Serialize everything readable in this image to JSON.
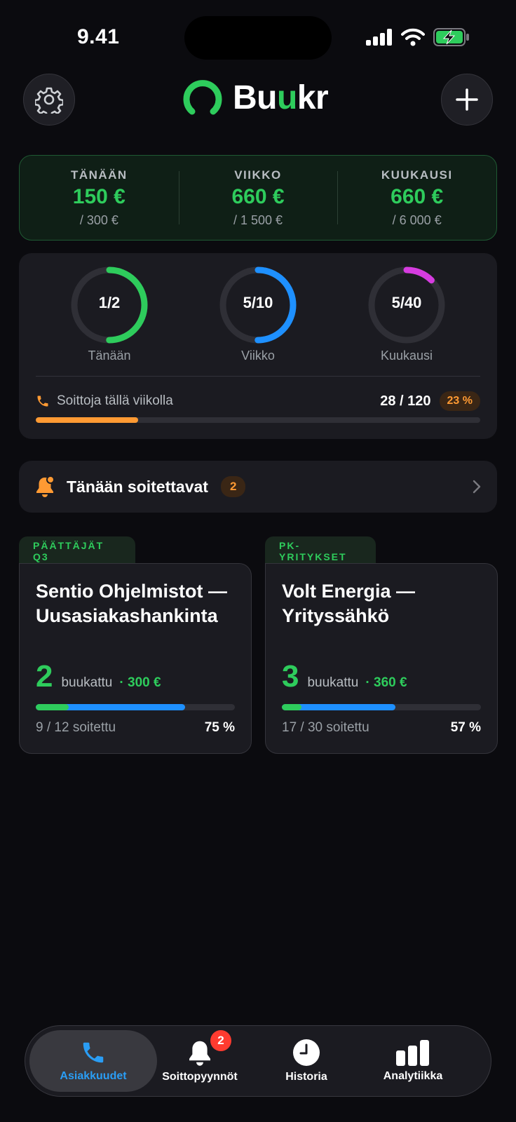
{
  "status_bar": {
    "time": "9.41"
  },
  "brand": {
    "name_part1": "Bu",
    "name_part2": "u",
    "name_part3": "kr"
  },
  "earnings": [
    {
      "label": "TÄNÄÄN",
      "value": "150 €",
      "target": "/ 300 €"
    },
    {
      "label": "VIIKKO",
      "value": "660 €",
      "target": "/ 1 500 €"
    },
    {
      "label": "KUUKAUSI",
      "value": "660 €",
      "target": "/ 6 000 €"
    }
  ],
  "bookings_progress": [
    {
      "center": "1/2",
      "label": "Tänään",
      "fraction": 0.5,
      "color": "#2ecc5c"
    },
    {
      "center": "5/10",
      "label": "Viikko",
      "fraction": 0.5,
      "color": "#1e90ff"
    },
    {
      "center": "5/40",
      "label": "Kuukausi",
      "fraction": 0.125,
      "color": "#d63ce0"
    }
  ],
  "weekly_calls": {
    "label": "Soittoja tällä viikolla",
    "count": "28 / 120",
    "percent": "23 %",
    "fraction": 0.23,
    "color": "#ff9a33"
  },
  "reminder": {
    "title": "Tänään soitettavat",
    "badge": "2"
  },
  "campaigns": [
    {
      "tag": "PÄÄTTÄJÄT Q3",
      "title": "Sentio Ohjelmistot — Uusasiakashankinta",
      "booked_count": "2",
      "booked_label": "buukattu",
      "amount": "· 300 €",
      "called": "9 / 12 soitettu",
      "percent": "75 %",
      "booked_fraction": 0.1667,
      "called_fraction": 0.75
    },
    {
      "tag": "PK-YRITYKSET",
      "title": "Volt Energia — Yrityssähkö",
      "booked_count": "3",
      "booked_label": "buukattu",
      "amount": "· 360 €",
      "called": "17 / 30 soitettu",
      "percent": "57 %",
      "booked_fraction": 0.1,
      "called_fraction": 0.57
    }
  ],
  "tabbar": {
    "items": [
      {
        "label": "Asiakkuudet",
        "icon": "phone-icon",
        "active": true
      },
      {
        "label": "Soittopyynnöt",
        "icon": "bell-icon",
        "badge": "2"
      },
      {
        "label": "Historia",
        "icon": "clock-icon"
      },
      {
        "label": "Analytiikka",
        "icon": "bar-chart-icon"
      }
    ]
  },
  "colors": {
    "accent_green": "#2ecc5c",
    "accent_blue": "#1e90ff",
    "accent_orange": "#ff9a33",
    "badge_red": "#ff3b30"
  }
}
